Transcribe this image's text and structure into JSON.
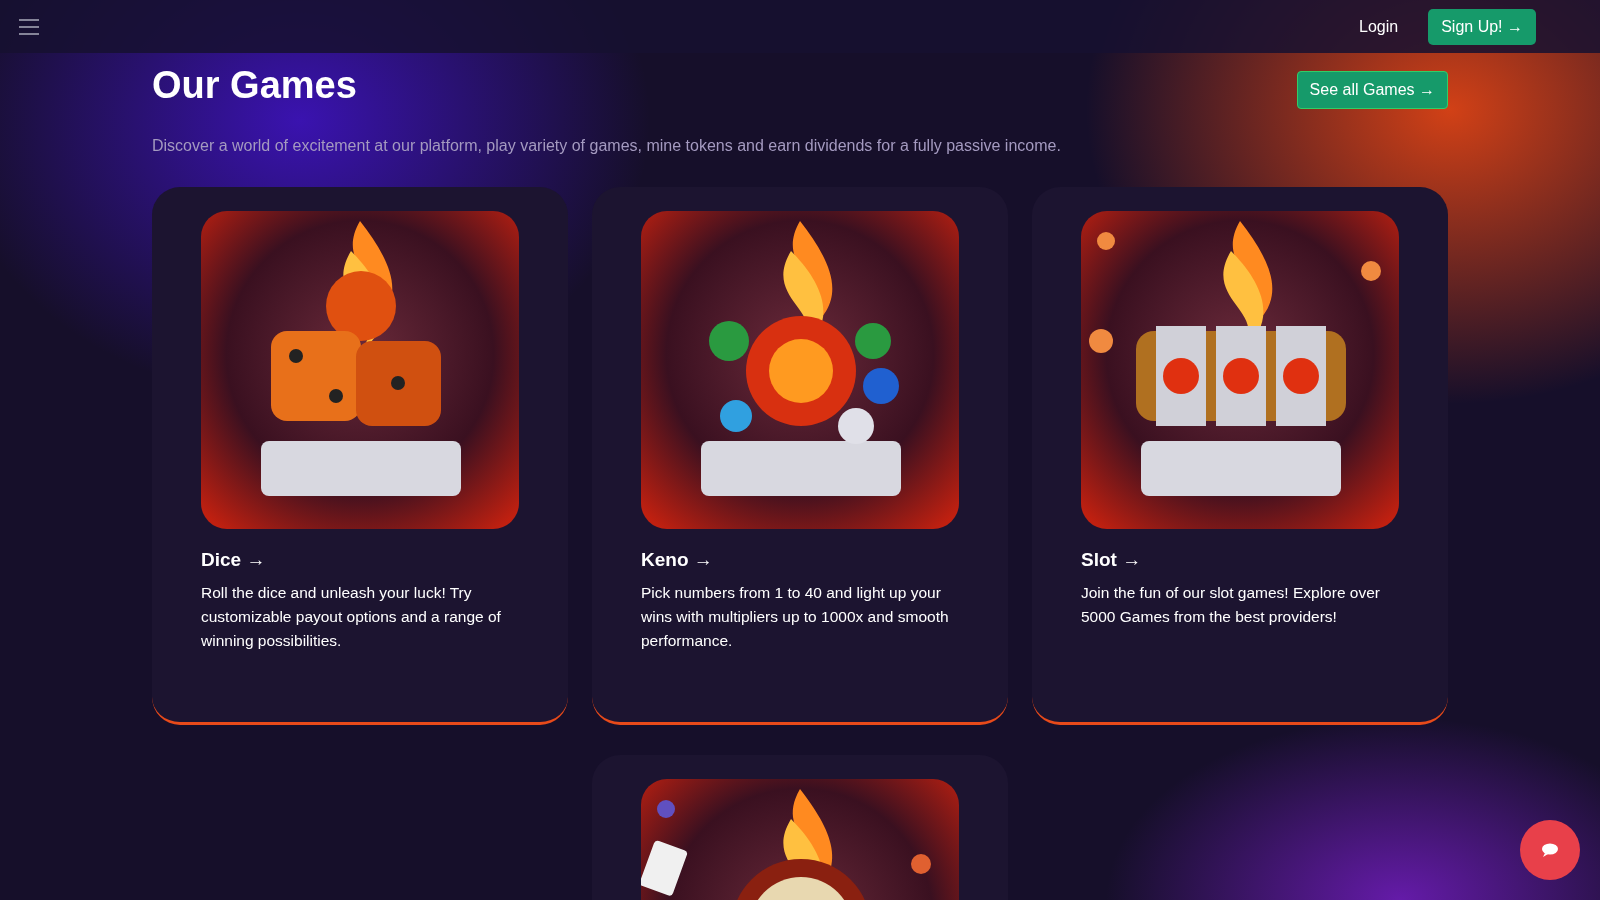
{
  "header": {
    "login": "Login",
    "signup": "Sign Up! →"
  },
  "section": {
    "title": "Our Games",
    "see_all": "See all Games →",
    "description": "Discover a world of excitement at our platform, play variety of games, mine tokens and earn dividends for a fully passive income."
  },
  "games": [
    {
      "kind": "dice",
      "title": "Dice →",
      "description": "Roll the dice and unleash your luck! Try customizable payout options and a range of winning possibilities."
    },
    {
      "kind": "keno",
      "title": "Keno →",
      "description": "Pick numbers from 1 to 40 and light up your wins with multipliers up to 1000x and smooth performance."
    },
    {
      "kind": "slot",
      "title": "Slot →",
      "description": "Join the fun of our slot games! Explore over 5000 Games from the best providers!"
    },
    {
      "kind": "roulette"
    }
  ]
}
